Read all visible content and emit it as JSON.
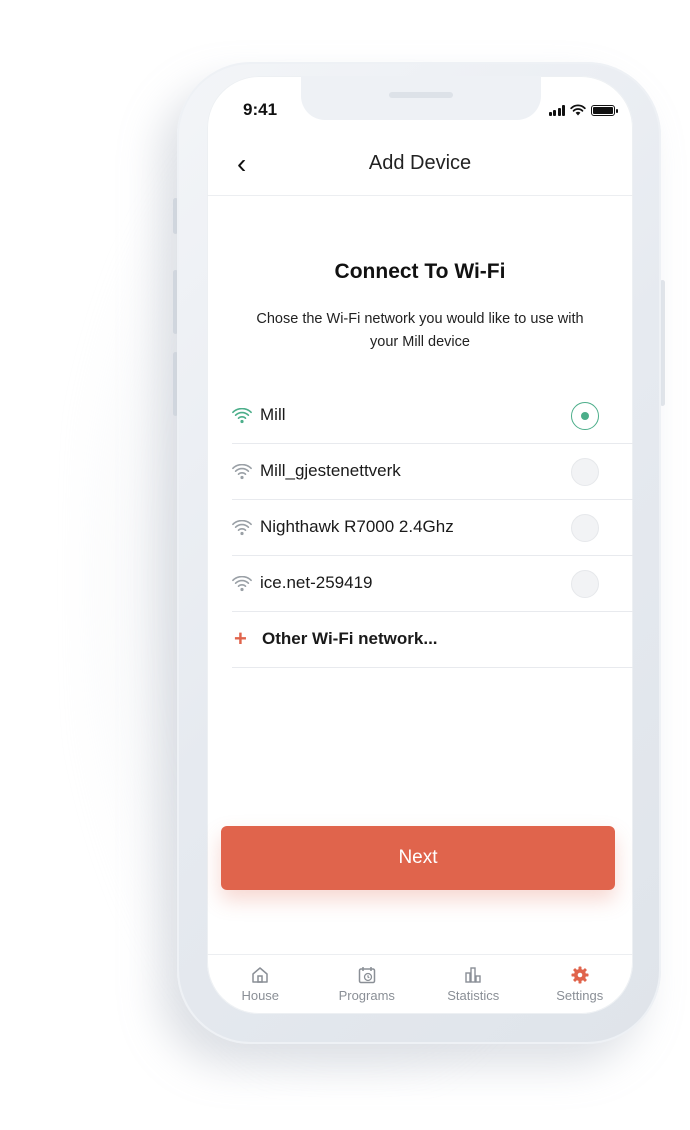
{
  "status_bar": {
    "time": "9:41"
  },
  "nav": {
    "back_glyph": "‹",
    "title": "Add Device"
  },
  "content": {
    "heading": "Connect To Wi-Fi",
    "subtitle": "Chose the Wi-Fi network you would like  to use with your Mill device"
  },
  "networks": [
    {
      "name": "Mill",
      "selected": true
    },
    {
      "name": "Mill_gjestenettverk",
      "selected": false
    },
    {
      "name": "Nighthawk R7000 2.4Ghz",
      "selected": false
    },
    {
      "name": "ice.net-259419",
      "selected": false
    }
  ],
  "other_network": {
    "plus": "+",
    "label": "Other Wi-Fi network..."
  },
  "next_button": {
    "label": "Next"
  },
  "tabs": [
    {
      "label": "House",
      "icon": "house-icon"
    },
    {
      "label": "Programs",
      "icon": "calendar-clock-icon"
    },
    {
      "label": "Statistics",
      "icon": "bar-chart-icon"
    },
    {
      "label": "Settings",
      "icon": "gear-icon",
      "active": true
    }
  ],
  "colors": {
    "accent": "#e0644c",
    "selected_green": "#4cae8a",
    "wifi_inactive": "#9aa0a6"
  }
}
